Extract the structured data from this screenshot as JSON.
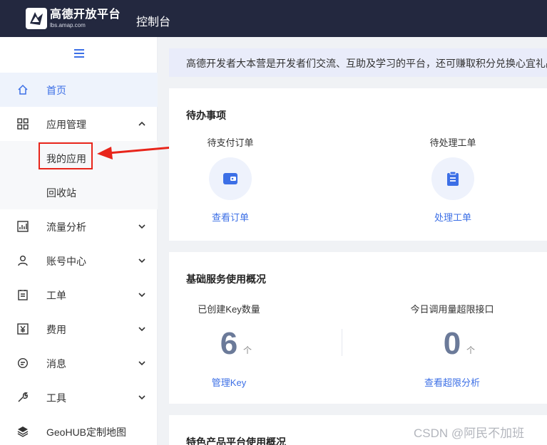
{
  "header": {
    "logo_cn": "高德开放平台",
    "logo_en": "lbs.amap.com",
    "console_label": "控制台"
  },
  "sidebar": {
    "items": [
      {
        "label": "首页",
        "icon": "home-icon",
        "active": true
      },
      {
        "label": "应用管理",
        "icon": "grid-icon",
        "expanded": true
      },
      {
        "label": "流量分析",
        "icon": "chart-icon"
      },
      {
        "label": "账号中心",
        "icon": "user-icon"
      },
      {
        "label": "工单",
        "icon": "clipboard-icon"
      },
      {
        "label": "费用",
        "icon": "yen-icon"
      },
      {
        "label": "消息",
        "icon": "message-icon"
      },
      {
        "label": "工具",
        "icon": "wrench-icon"
      },
      {
        "label": "GeoHUB定制地图",
        "icon": "layers-icon"
      }
    ],
    "subitems": [
      {
        "label": "我的应用"
      },
      {
        "label": "回收站"
      }
    ]
  },
  "notice": "高德开发者大本营是开发者们交流、互助及学习的平台，还可赚取积分兑换心宜礼品",
  "todo": {
    "title": "待办事项",
    "items": [
      {
        "label": "待支付订单",
        "link": "查看订单",
        "icon": "wallet-icon"
      },
      {
        "label": "待处理工单",
        "link": "处理工单",
        "icon": "clipboard-icon"
      }
    ]
  },
  "usage": {
    "title": "基础服务使用概况",
    "stats": [
      {
        "label": "已创建Key数量",
        "value": "6",
        "trend": "个",
        "link": "管理Key"
      },
      {
        "label": "今日调用量超限接口",
        "value": "0",
        "trend": "个",
        "link": "查看超限分析"
      }
    ]
  },
  "featured": {
    "title": "特色产品平台使用概况"
  },
  "watermark": "CSDN @阿民不加班",
  "colors": {
    "topbar": "#23283f",
    "accent": "#3c6fe6",
    "highlight": "#e8251b"
  }
}
